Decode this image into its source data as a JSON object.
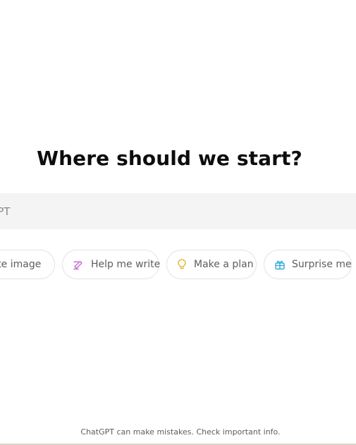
{
  "main": {
    "headline": "Where should we start?",
    "composer": {
      "placeholder": "hatGPT"
    },
    "suggestions": [
      {
        "label": "eate image",
        "icon": "image-icon"
      },
      {
        "label": "Help me write",
        "icon": "pen-write-icon",
        "color": "#c26ad1"
      },
      {
        "label": "Make a plan",
        "icon": "lightbulb-icon",
        "color": "#e2b52b"
      },
      {
        "label": "Surprise me",
        "icon": "gift-icon",
        "color": "#35a9d6"
      }
    ]
  },
  "footer": {
    "disclaimer": "ChatGPT can make mistakes. Check important info."
  }
}
